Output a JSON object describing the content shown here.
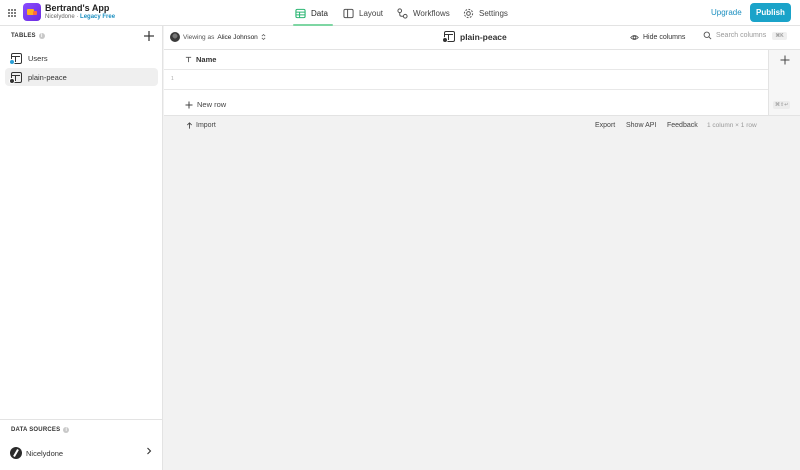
{
  "app": {
    "name": "Bertrand's App",
    "owner": "Nicelydone",
    "separator": "·",
    "plan": "Legacy Free"
  },
  "nav": {
    "data": "Data",
    "layout": "Layout",
    "workflows": "Workflows",
    "settings": "Settings",
    "active": "data"
  },
  "header_actions": {
    "upgrade": "Upgrade",
    "publish": "Publish"
  },
  "sidebar": {
    "tables_heading": "TABLES",
    "tables": [
      {
        "label": "Users",
        "icon": "users-table-icon",
        "selected": false
      },
      {
        "label": "plain-peace",
        "icon": "table-icon",
        "selected": true
      }
    ],
    "data_sources_heading": "DATA SOURCES",
    "data_sources": [
      {
        "label": "Nicelydone"
      }
    ]
  },
  "toolbar": {
    "viewing_prefix": "Viewing as",
    "viewing_user": "Alice Johnson",
    "table_title": "plain-peace",
    "hide_columns": "Hide columns",
    "search_placeholder": "Search columns",
    "search_shortcut": "⌘K"
  },
  "grid": {
    "columns": [
      {
        "name": "Name",
        "type": "text"
      }
    ],
    "rows": [
      {
        "number": "1",
        "Name": ""
      }
    ],
    "new_row_label": "New row",
    "new_row_shortcut": "⌘⇧↵"
  },
  "footer": {
    "import": "Import",
    "export": "Export",
    "show_api": "Show API",
    "feedback": "Feedback",
    "summary": "1 column × 1 row"
  },
  "colors": {
    "accent": "#1aa3c9",
    "link": "#1b8fc0",
    "active_tab_underline": "#7ed6a3"
  }
}
